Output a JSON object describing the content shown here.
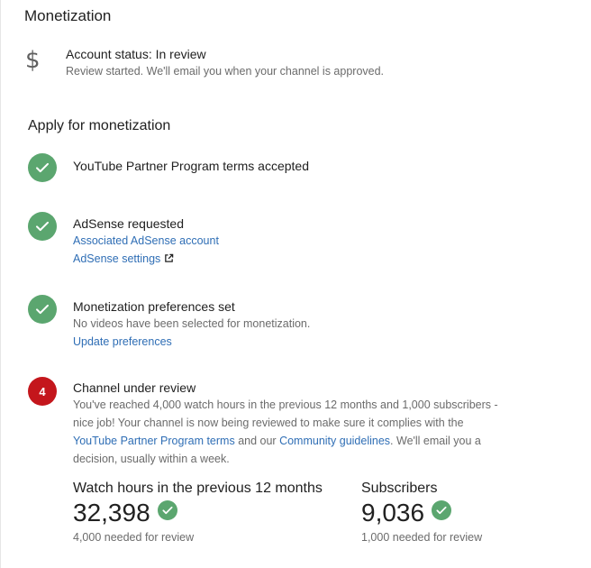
{
  "page": {
    "title": "Monetization"
  },
  "account": {
    "icon": "dollar-icon",
    "status": "Account status: In review",
    "description": "Review started. We'll email you when your channel is approved."
  },
  "apply": {
    "title": "Apply for monetization",
    "steps": [
      {
        "state": "done",
        "title": "YouTube Partner Program terms accepted"
      },
      {
        "state": "done",
        "title": "AdSense requested",
        "links": [
          "Associated AdSense account",
          "AdSense settings"
        ]
      },
      {
        "state": "done",
        "title": "Monetization preferences set",
        "description": "No videos have been selected for monetization.",
        "links": [
          "Update preferences"
        ]
      },
      {
        "state": "pending",
        "number": "4",
        "title": "Channel under review",
        "description_part1": "You've reached 4,000 watch hours in the previous 12 months and 1,000 subscribers - nice job! Your channel is now being reviewed to make sure it complies with the ",
        "link1": "YouTube Partner Program terms",
        "description_part2": " and our ",
        "link2": "Community guidelines",
        "description_part3": ". We'll email you a decision, usually within a week."
      }
    ]
  },
  "stats": [
    {
      "label": "Watch hours in the previous 12 months",
      "value": "32,398",
      "note": "4,000 needed for review"
    },
    {
      "label": "Subscribers",
      "value": "9,036",
      "note": "1,000 needed for review"
    }
  ],
  "colors": {
    "check": "#5ba66f",
    "badge": "#c4161c",
    "link": "#2f6eb5"
  }
}
